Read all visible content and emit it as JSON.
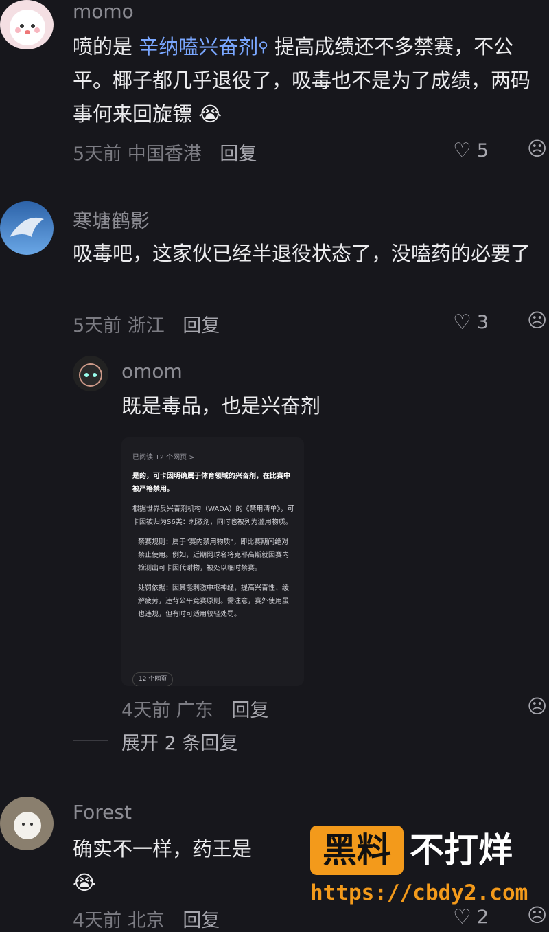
{
  "comments": [
    {
      "user": "momo",
      "text_before_link": "喷的是 ",
      "link": "辛纳嗑兴奋剂",
      "text_after_link": " 提高成绩还不多禁赛，不公平。椰子都几乎退役了，吸毒也不是为了成绩，两码事何来回旋镖",
      "time": "5天前",
      "location": "中国香港",
      "reply": "回复",
      "likes": "5"
    },
    {
      "user": "寒塘鹤影",
      "text": "吸毒吧，这家伙已经半退役状态了，没嗑药的必要了",
      "time": "5天前",
      "location": "浙江",
      "reply": "回复",
      "likes": "3"
    },
    {
      "user": "omom",
      "text": "既是毒品，也是兴奋剂",
      "time": "4天前",
      "location": "广东",
      "reply": "回复"
    },
    {
      "user": "Forest",
      "text": "确实不一样，药王是",
      "time": "4天前",
      "location": "北京",
      "reply": "回复",
      "likes": "2"
    }
  ],
  "expand_label": "展开 2 条回复",
  "screenshot": {
    "header": "已阅读 12 个网页 >",
    "p1": "是的，可卡因明确属于体育领域的兴奋剂，在比赛中被严格禁用。",
    "p2": "根据世界反兴奋剂机构（WADA）的《禁用清单》，可卡因被归为S6类：刺激剂，同时也被列为滥用物质。",
    "b1": "禁赛规则：属于\"赛内禁用物质\"，即比赛期间绝对禁止使用。例如，近期网球名将克耶高斯就因赛内检测出可卡因代谢物，被处以临时禁赛。",
    "b2": "处罚依据：因其能刺激中枢神经，提高兴奋性、缓解疲劳，违背公平竞赛原则。需注意，赛外使用虽也违规，但有时可适用较轻处罚。",
    "sources": "12 个网页"
  },
  "watermark": {
    "brand": "黑料",
    "slogan": "不打烊",
    "url": "https://cbdy2.com"
  }
}
